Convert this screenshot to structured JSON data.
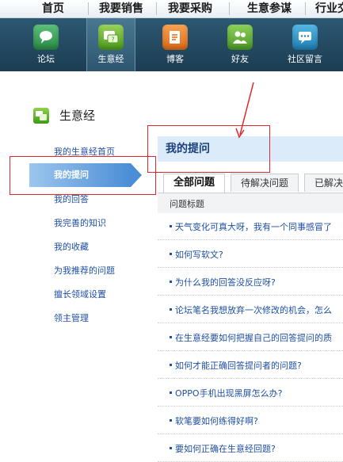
{
  "top_nav": [
    "首页",
    "我要销售",
    "我要采购",
    "生意参谋",
    "行业交"
  ],
  "icon_bar": {
    "tiles": [
      {
        "label": "论坛",
        "icon": "forum-bubble-icon",
        "color": "#3a9b55"
      },
      {
        "label": "生意经",
        "icon": "business-question-icon",
        "color": "#6fb52d",
        "active": true
      },
      {
        "label": "博客",
        "icon": "blog-notepad-icon",
        "color": "#ef7d2a"
      },
      {
        "label": "好友",
        "icon": "friends-icon",
        "color": "#62a83a"
      },
      {
        "label": "社区留言",
        "icon": "message-board-icon",
        "color": "#2a92c6"
      }
    ]
  },
  "section": {
    "title": "生意经",
    "icon": "business-question-icon"
  },
  "sidebar": {
    "items": [
      {
        "label": "我的生意经首页"
      },
      {
        "label": "我的提问",
        "active": true
      },
      {
        "label": "我的回答"
      },
      {
        "label": "我完善的知识"
      },
      {
        "label": "我的收藏"
      },
      {
        "label": "为我推荐的问题"
      },
      {
        "label": "擅长领域设置"
      },
      {
        "label": "领主管理"
      }
    ]
  },
  "main": {
    "title": "我的提问",
    "tabs": [
      "全部问题",
      "待解决问题",
      "已解决"
    ],
    "column_header": "问题标题",
    "questions": [
      "天气变化可真大呀，我有一个同事感冒了",
      "如何写软文?",
      "为什么我的回答没反应呀?",
      "论坛笔名我想放弃一次修改的机会，怎么",
      "在生意经要如何把握自己的回答提问的质",
      "如何才能正确回答提问者的问题?",
      "OPPO手机出现黑屏怎么办?",
      "软笔要如何练得好啊?",
      "要如何正确在生意经回题?"
    ]
  },
  "annotation_color": "#e0272b"
}
